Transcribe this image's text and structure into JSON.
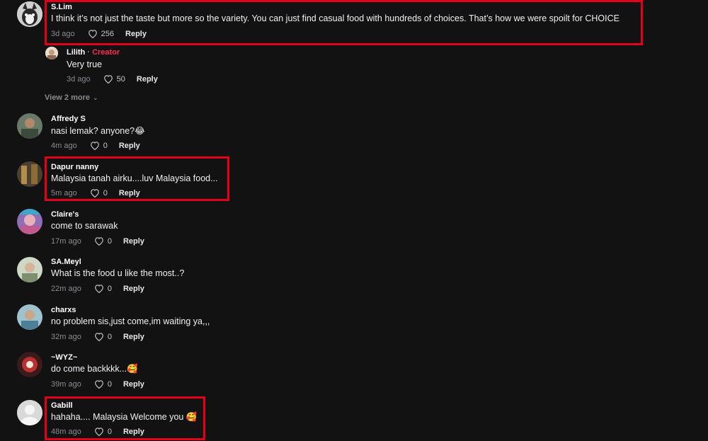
{
  "comments": [
    {
      "username": "S.Lim",
      "text": "I think it’s not just the taste but more so the variety. You can just find casual food with hundreds of choices. That’s how we were spoilt for CHOICE",
      "time": "3d ago",
      "likes": "256",
      "reply": "Reply"
    },
    {
      "username": "Lilith",
      "creator_sep": " · ",
      "creator_label": "Creator",
      "text": "Very true",
      "time": "3d ago",
      "likes": "50",
      "reply": "Reply"
    },
    {
      "username": "Affredy S",
      "text": "nasi lemak? anyone?😂",
      "time": "4m ago",
      "likes": "0",
      "reply": "Reply"
    },
    {
      "username": "Dapur nanny",
      "text": "Malaysia tanah airku....luv Malaysia food...",
      "time": "5m ago",
      "likes": "0",
      "reply": "Reply"
    },
    {
      "username": "Claire's",
      "text": "come to sarawak",
      "time": "17m ago",
      "likes": "0",
      "reply": "Reply"
    },
    {
      "username": "SA.Meyl",
      "text": "What is the food u like the most..?",
      "time": "22m ago",
      "likes": "0",
      "reply": "Reply"
    },
    {
      "username": "charxs",
      "text": "no problem sis,just come,im waiting ya,,,",
      "time": "32m ago",
      "likes": "0",
      "reply": "Reply"
    },
    {
      "username": "~WYZ~",
      "text": "do come backkkk...🥰",
      "time": "39m ago",
      "likes": "0",
      "reply": "Reply"
    },
    {
      "username": "Gabill",
      "text": "hahaha.... Malaysia Welcome you 🥰",
      "time": "48m ago",
      "likes": "0",
      "reply": "Reply"
    }
  ],
  "view_more": "View 2 more",
  "colors": {
    "highlight": "#e2001a",
    "creator": "#fe2c55",
    "background": "#121212"
  }
}
